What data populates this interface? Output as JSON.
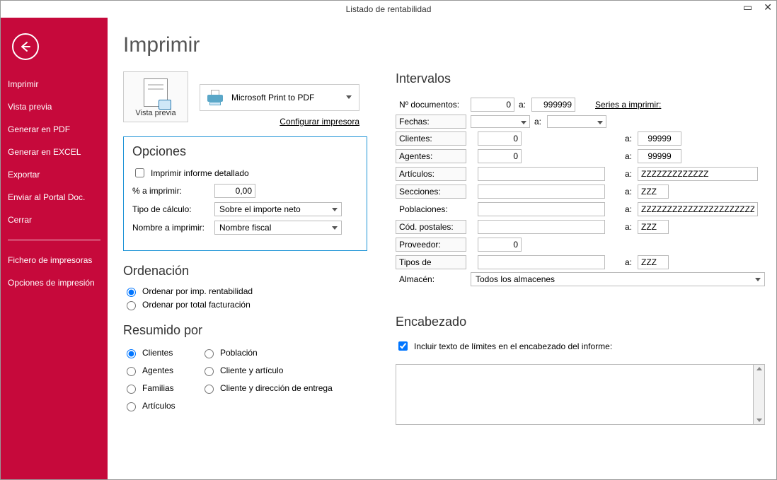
{
  "window": {
    "title": "Listado de rentabilidad"
  },
  "sidebar": {
    "items": [
      "Imprimir",
      "Vista previa",
      "Generar en PDF",
      "Generar en EXCEL",
      "Exportar",
      "Enviar al Portal Doc.",
      "Cerrar"
    ],
    "footer": [
      "Fichero de impresoras",
      "Opciones de impresión"
    ]
  },
  "main": {
    "title": "Imprimir",
    "preview_label": "Vista previa",
    "printer_selected": "Microsoft Print to PDF",
    "configure_link": "Configurar impresora"
  },
  "opciones": {
    "title": "Opciones",
    "detallado_label": "Imprimir informe detallado",
    "pct_label": "% a imprimir:",
    "pct_value": "0,00",
    "tipo_calc_label": "Tipo de cálculo:",
    "tipo_calc_value": "Sobre el importe neto",
    "nombre_label": "Nombre a imprimir:",
    "nombre_value": "Nombre fiscal"
  },
  "ordenacion": {
    "title": "Ordenación",
    "opt1": "Ordenar por imp. rentabilidad",
    "opt2": "Ordenar por total facturación"
  },
  "resumido": {
    "title": "Resumido por",
    "opts_left": [
      "Clientes",
      "Agentes",
      "Familias",
      "Artículos"
    ],
    "opts_right": [
      "Población",
      "Cliente y artículo",
      "Cliente y dirección de entrega"
    ]
  },
  "intervalos": {
    "title": "Intervalos",
    "a": "a:",
    "series_link": "Series a imprimir:",
    "rows": {
      "ndoc": {
        "label": "Nº documentos:",
        "from": "0",
        "to": "999999"
      },
      "fechas": {
        "label": "Fechas:",
        "from": "",
        "to": ""
      },
      "clientes": {
        "label": "Clientes:",
        "from": "0",
        "to": "99999"
      },
      "agentes": {
        "label": "Agentes:",
        "from": "0",
        "to": "99999"
      },
      "articulos": {
        "label": "Artículos:",
        "from": "",
        "to": "ZZZZZZZZZZZZZ"
      },
      "secciones": {
        "label": "Secciones:",
        "from": "",
        "to": "ZZZ"
      },
      "poblaciones": {
        "label": "Poblaciones:",
        "from": "",
        "to": "ZZZZZZZZZZZZZZZZZZZZZZZZZZZZZZ"
      },
      "cpostales": {
        "label": "Cód. postales:",
        "from": "",
        "to": "ZZZ"
      },
      "proveedor": {
        "label": "Proveedor:",
        "from": "0"
      },
      "tipos": {
        "label": "Tipos de",
        "from": "",
        "to": "ZZZ"
      },
      "almacen": {
        "label": "Almacén:",
        "value": "Todos los almacenes"
      }
    }
  },
  "encabezado": {
    "title": "Encabezado",
    "check_label": "Incluir texto de límites en el encabezado del informe:",
    "text": ""
  }
}
